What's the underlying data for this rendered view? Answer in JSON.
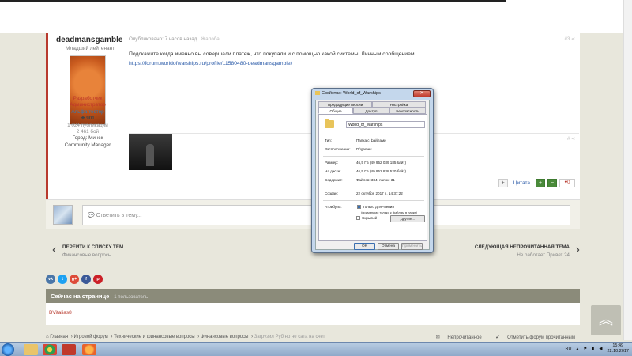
{
  "post": {
    "author_name": "deadmansgamble",
    "author_rank": "Младший лейтенант",
    "roles": [
      "Разработчик",
      "Администратор",
      "Альфа-тестер"
    ],
    "rating": "901",
    "posts_count": "1 024 публикации",
    "battles": "2 461 бой",
    "city_label": "Город: Минск",
    "title": "Community Manager",
    "meta": "Опубликовано: 7 часов назад",
    "warn": "Жалоба",
    "share": "#3  ⋖",
    "share2": "#  ⋖",
    "text": "Подскажите когда именно вы совершали платеж, что покупали и с помощью какой системы. Личным сообщением",
    "link": "https://forum.worldofwarships.ru/profile/11580480-deadmansgamble/",
    "quote_label": "Цитата",
    "like_count": "0"
  },
  "reply": {
    "placeholder": "Ответить в тему..."
  },
  "nav": {
    "prev_label": "ПЕРЕЙТИ К СПИСКУ ТЕМ",
    "prev_sub": "Финансовые вопросы",
    "next_label": "СЛЕДУЮЩАЯ НЕПРОЧИТАННАЯ ТЕМА",
    "next_sub": "Не работает Привет 24"
  },
  "social": [
    "vk",
    "tw",
    "g+",
    "f",
    "p"
  ],
  "online": {
    "title": "Сейчас на странице",
    "count": "1 пользователь",
    "user": "BVitalias8"
  },
  "breadcrumb": {
    "items": [
      "Главная",
      "Игровой форум",
      "Технические и финансовые вопросы",
      "Финансовые вопросы"
    ],
    "last": "Загрузил Руб но не сата на счет",
    "unread": "Непрочитанное",
    "mark_read": "Отметить форум прочитанным"
  },
  "dialog": {
    "title": "Свойства: World_of_Warships",
    "tabs_row1": [
      "Предыдущие версии",
      "Настройка"
    ],
    "tabs_row2": [
      "Общие",
      "Доступ",
      "Безопасность"
    ],
    "folder_name": "World_of_Warships",
    "type_label": "Тип:",
    "type_value": "Папка с файлами",
    "location_label": "Расположение:",
    "location_value": "D:\\games",
    "size_label": "Размер:",
    "size_value": "46,5 ГБ (49 952 039 185 байт)",
    "disk_label": "На диске:",
    "disk_value": "46,5 ГБ (49 952 838 520 байт)",
    "contains_label": "Содержит:",
    "contains_value": "Файлов: 384; папок: 31",
    "created_label": "Создан:",
    "created_value": "22 октября 2017 г., 14:37:22",
    "attrs_label": "Атрибуты:",
    "readonly": "Только для чтения",
    "readonly_note": "(применимо только к файлам в папке)",
    "hidden": "Скрытый",
    "other_button": "Другие...",
    "ok": "OK",
    "cancel": "Отмена",
    "apply": "Применить"
  },
  "taskbar": {
    "lang": "RU",
    "time": "15:49",
    "date": "22.10.2017"
  }
}
